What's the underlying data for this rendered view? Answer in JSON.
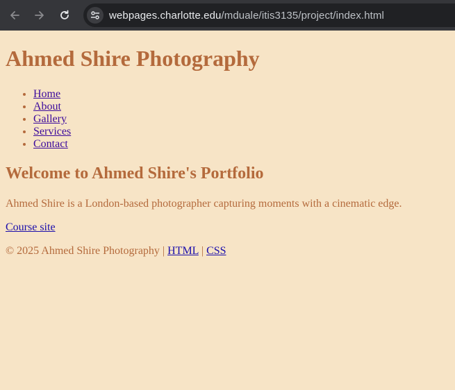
{
  "browser": {
    "url_host": "webpages.charlotte.edu",
    "url_path": "/mduale/itis3135/project/index.html"
  },
  "site": {
    "title": "Ahmed Shire Photography",
    "nav": [
      "Home",
      "About",
      "Gallery",
      "Services",
      "Contact"
    ]
  },
  "main": {
    "heading": "Welcome to Ahmed Shire's Portfolio",
    "intro": "Ahmed Shire is a London-based photographer capturing moments with a cinematic edge.",
    "course_link": "Course site"
  },
  "footer": {
    "copyright": "© 2025 Ahmed Shire Photography",
    "sep1": " | ",
    "html_link": "HTML",
    "sep2": " | ",
    "css_link": "CSS"
  }
}
